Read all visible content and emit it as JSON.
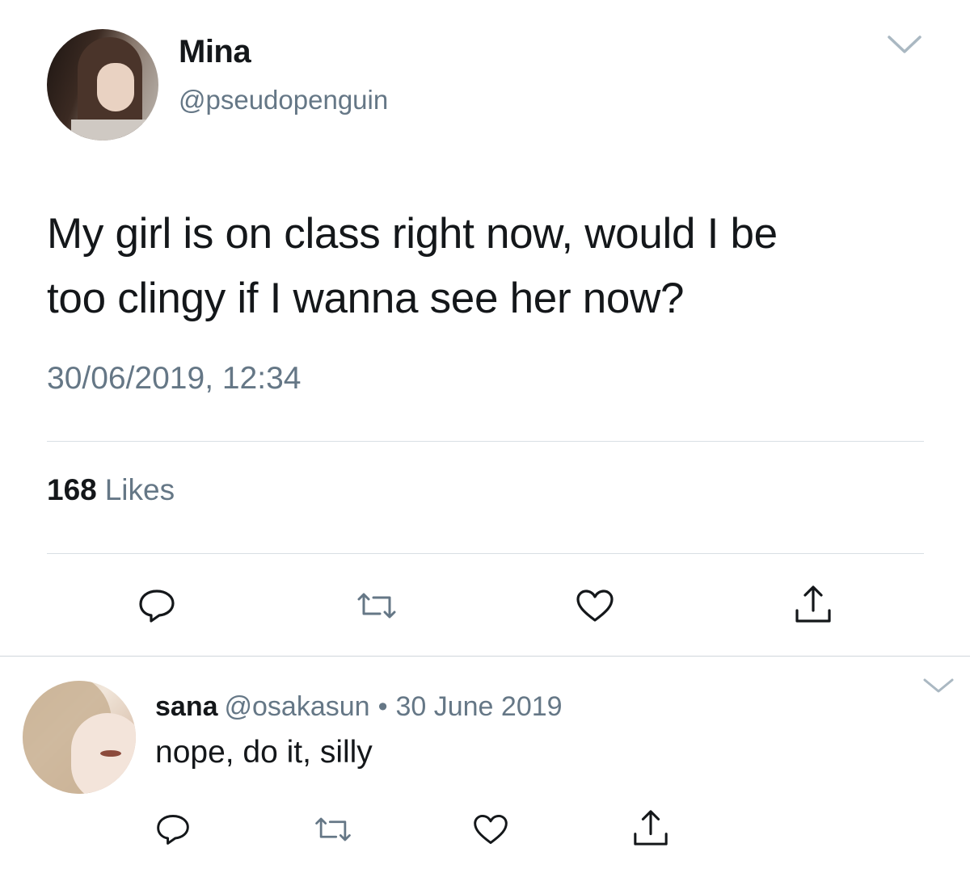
{
  "main_tweet": {
    "author_name": "Mina",
    "author_handle": "@pseudopenguin",
    "text_line1": "My girl is on class right now, would I be",
    "text_line2": "too clingy if I wanna see her now?",
    "timestamp": "30/06/2019, 12:34",
    "like_count": "168",
    "like_label": "Likes"
  },
  "reply_tweet": {
    "author_name": "sana",
    "author_handle": "@osakasun",
    "separator": "•",
    "date": "30 June 2019",
    "text": "nope, do it, silly"
  },
  "icons": {
    "reply": "reply-icon",
    "retweet": "retweet-icon",
    "like": "heart-icon",
    "share": "share-icon",
    "more": "chevron-down-icon"
  },
  "colors": {
    "text_primary": "#14171a",
    "text_secondary": "#657786",
    "divider": "#d9dfe4",
    "chevron": "#aab8c2"
  }
}
